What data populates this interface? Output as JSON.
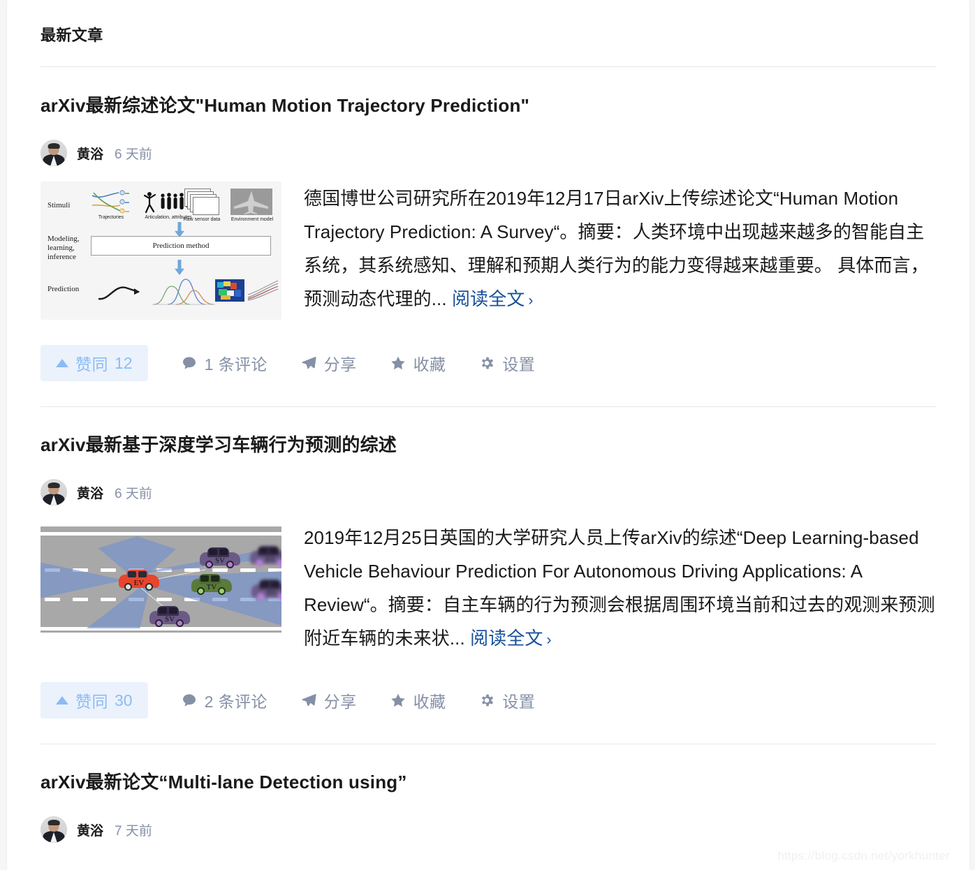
{
  "header": {
    "title": "最新文章"
  },
  "watermark": "https://blog.csdn.net/yorkhunter",
  "actions_labels": {
    "vote": "赞同",
    "share": "分享",
    "collect": "收藏",
    "settings": "设置"
  },
  "read_more": {
    "label": "阅读全文",
    "chevron": "›",
    "ellipsis": "..."
  },
  "colors": {
    "link_blue": "#175199",
    "vote_pill_bg": "#ebf2fc",
    "vote_pill_text": "#8bbbf5",
    "secondary_text": "#8590a6",
    "primary_text": "#1a1a1a",
    "divider": "#e3e8ed",
    "page_bg": "#f6f6f6",
    "card_bg": "#ffffff"
  },
  "articles": [
    {
      "title": "arXiv最新综述论文\"Human Motion Trajectory Prediction\"",
      "author": "黄浴",
      "time": "6 天前",
      "excerpt": "德国博世公司研究所在2019年12月17日arXiv上传综述论文“Human Motion Trajectory Prediction: A Survey“。摘要：人类环境中出现越来越多的智能自主系统，其系统感知、理解和预期人类行为的能力变得越来越重要。 具体而言，预测动态代理的",
      "vote_count": "12",
      "comment_label": "1 条评论",
      "thumb": {
        "type": "pipeline-diagram",
        "row_labels": [
          "Stimuli",
          "Modeling, learning, inference",
          "Prediction"
        ],
        "stimuli_captions": [
          "Trajectories",
          "Articulation, attributes",
          "Raw sensor data",
          "Environment model"
        ],
        "method_box": "Prediction method"
      }
    },
    {
      "title": "arXiv最新基于深度学习车辆行为预测的综述",
      "author": "黄浴",
      "time": "6 天前",
      "excerpt": "2019年12月25日英国的大学研究人员上传arXiv的综述“Deep Learning-based Vehicle Behaviour Prediction For Autonomous Driving Applications: A Review“。摘要：自主车辆的行为预测会根据周围环境当前和过去的观测来预测附近车辆的未来状",
      "vote_count": "30",
      "comment_label": "2 条评论",
      "thumb": {
        "type": "road-scene",
        "vehicle_tags": [
          "EV",
          "TV",
          "SV",
          "SV",
          "SV",
          "SV"
        ]
      }
    },
    {
      "title": "arXiv最新论文“Multi-lane Detection using”",
      "author": "黄浴",
      "time": "7 天前"
    }
  ]
}
